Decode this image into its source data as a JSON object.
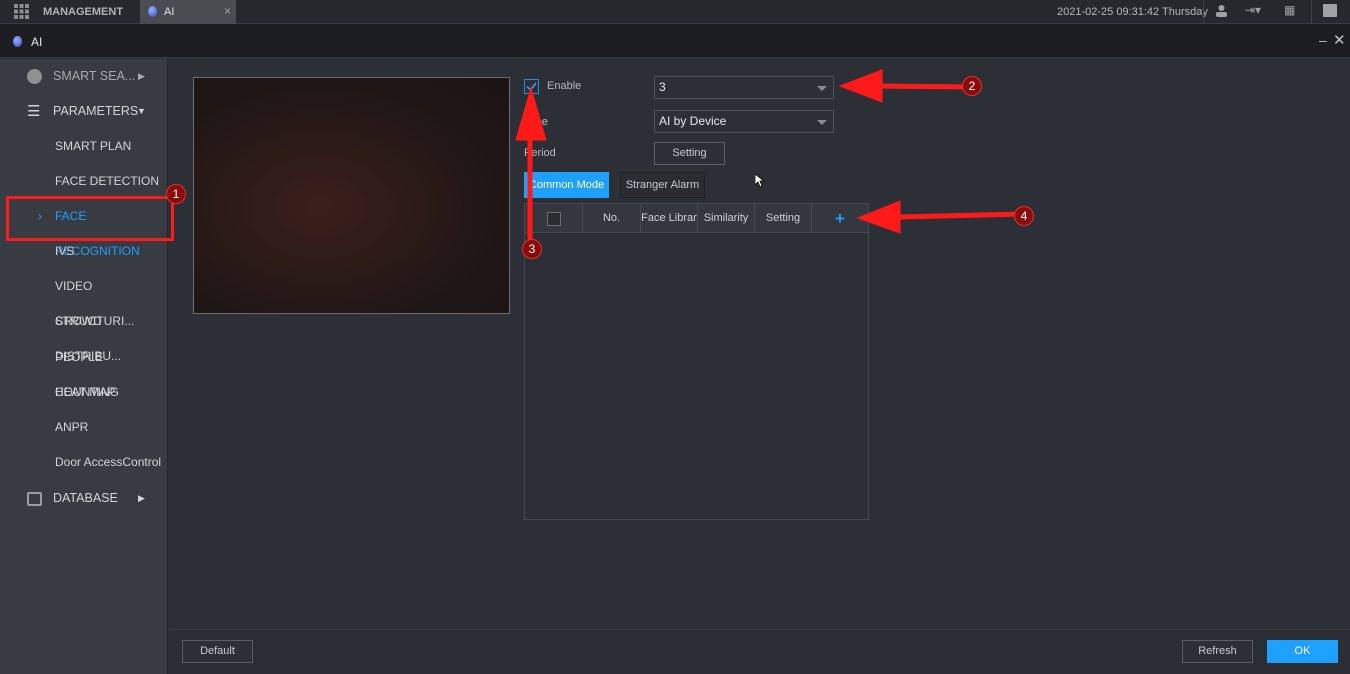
{
  "topbar": {
    "menu_label": "MANAGEMENT",
    "tab_label": "AI",
    "datetime": "2021-02-25 09:31:42 Thursday"
  },
  "titlebar": {
    "title": "AI"
  },
  "sidebar": {
    "smart_search": "SMART SEA...",
    "parameters": "PARAMETERS",
    "items": [
      "SMART PLAN",
      "FACE DETECTION",
      "FACE RECOGNITION",
      "IVS",
      "VIDEO STRUCTURI...",
      "CROWD DISTRIBU...",
      "PEOPLE COUNTING",
      "HEAT MAP",
      "ANPR",
      "Door AccessControl"
    ],
    "active_item": "FACE RECOGNITION",
    "database": "DATABASE"
  },
  "form": {
    "enable_label": "Enable",
    "enable_checked": true,
    "channel_value": "3",
    "type_label": "Type",
    "type_value": "AI by Device",
    "period_label": "Period",
    "period_button": "Setting"
  },
  "mode_tabs": [
    "Common Mode",
    "Stranger Alarm"
  ],
  "table": {
    "headers": [
      "No.",
      "Face Librar",
      "Similarity",
      "Setting"
    ],
    "add_icon": "+",
    "rows": []
  },
  "footer": {
    "default": "Default",
    "refresh": "Refresh",
    "ok": "OK"
  },
  "annotations": [
    "1",
    "2",
    "3",
    "4"
  ],
  "colors": {
    "accent": "#1ea0ff",
    "annotation": "#ff0000"
  }
}
